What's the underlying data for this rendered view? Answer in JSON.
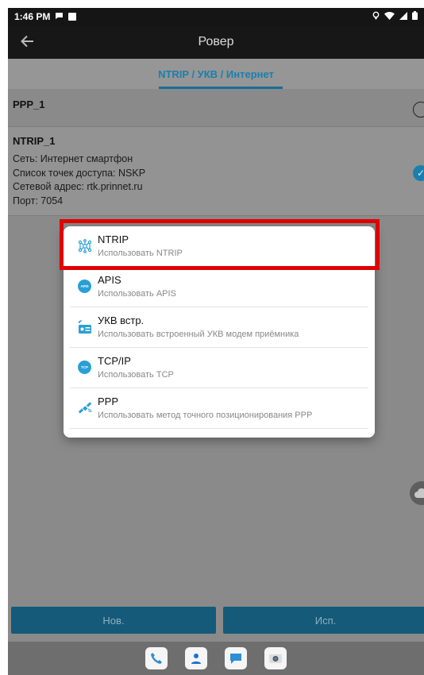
{
  "status_bar": {
    "time": "1:46 PM"
  },
  "app_bar": {
    "title": "Ровер"
  },
  "tab": {
    "label": "NTRIP / УКВ / Интернет"
  },
  "profiles": [
    {
      "name": "PPP_1"
    },
    {
      "name": "NTRIP_1",
      "details": [
        "Сеть: Интернет смартфон",
        "Список точек доступа: NSKP",
        "Сетевой адрес: rtk.prinnet.ru",
        "Порт: 7054"
      ]
    }
  ],
  "dialog": {
    "items": [
      {
        "title": "NTRIP",
        "subtitle": "Использовать NTRIP",
        "icon": "ntrip-network-icon"
      },
      {
        "title": "APIS",
        "subtitle": "Использовать APIS",
        "icon": "apis-icon",
        "badge": "APIS"
      },
      {
        "title": "УКВ встр.",
        "subtitle": "Использовать встроенный УКВ модем приёмника",
        "icon": "radio-modem-icon"
      },
      {
        "title": "TCP/IP",
        "subtitle": "Использовать TCP",
        "icon": "tcp-icon",
        "badge": "TCP"
      },
      {
        "title": "PPP",
        "subtitle": "Использовать метод точного позиционирования PPP",
        "icon": "satellite-icon"
      }
    ]
  },
  "buttons": {
    "new": "Нов.",
    "use": "Исп."
  },
  "colors": {
    "accent": "#1a7fae",
    "highlight": "#e00000"
  }
}
